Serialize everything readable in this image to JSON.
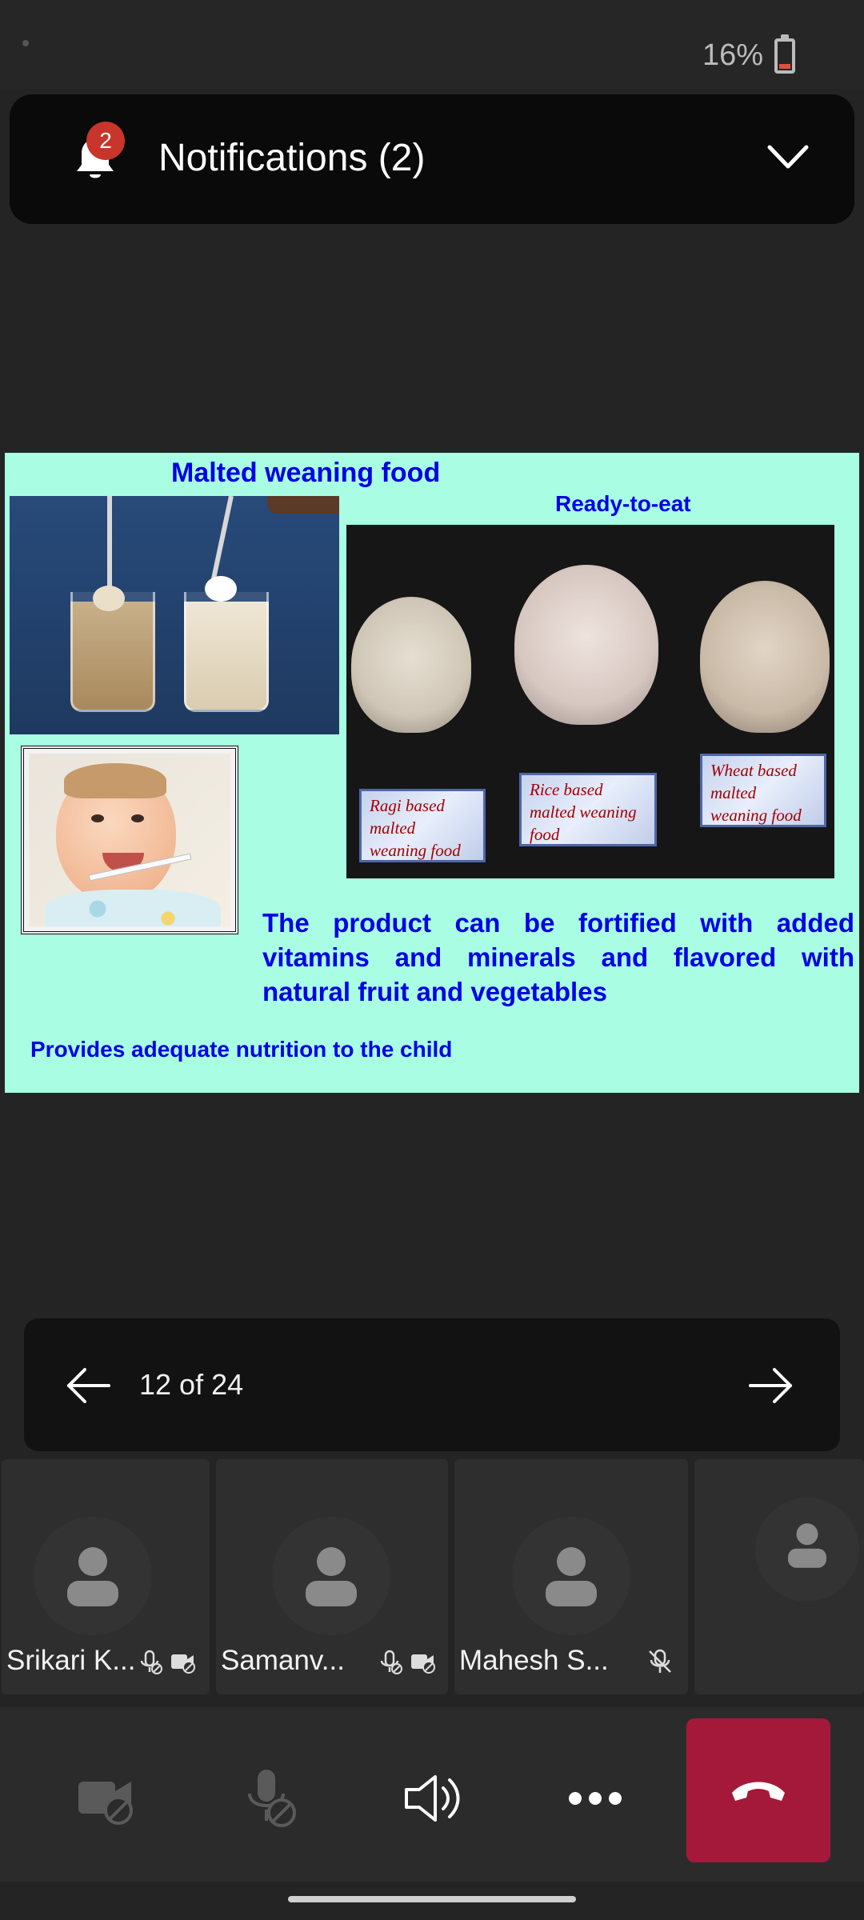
{
  "status": {
    "battery": "16%"
  },
  "notifications": {
    "title": "Notifications (2)",
    "badge": "2"
  },
  "slide": {
    "title": "Malted weaning food",
    "subtitle": "Ready-to-eat",
    "labels": [
      "Ragi based malted weaning food",
      "Rice based malted weaning food",
      "Wheat based malted weaning food"
    ],
    "body": "The product can be fortified with added vitamins and minerals and flavored with natural fruit and vegetables",
    "footer": "Provides  adequate nutrition to the child"
  },
  "pager": {
    "text": "12 of 24"
  },
  "participants": [
    {
      "name": "Srikari K...",
      "icons": [
        "mic-off-icon",
        "camera-off-icon"
      ]
    },
    {
      "name": "Samanv...",
      "icons": [
        "mic-off-icon",
        "camera-off-icon"
      ]
    },
    {
      "name": "Mahesh S...",
      "icons": [
        "muted-icon"
      ]
    },
    {
      "name": "",
      "icons": []
    }
  ],
  "controls": [
    "camera-off-icon",
    "mic-off-icon",
    "speaker-icon",
    "more-icon",
    "hang-up-icon"
  ],
  "colors": {
    "accent_red": "#a4193a",
    "badge": "#c8352a",
    "slide_bg": "#a9fde3",
    "slide_text": "#0000e6",
    "label_text": "#a10000"
  }
}
